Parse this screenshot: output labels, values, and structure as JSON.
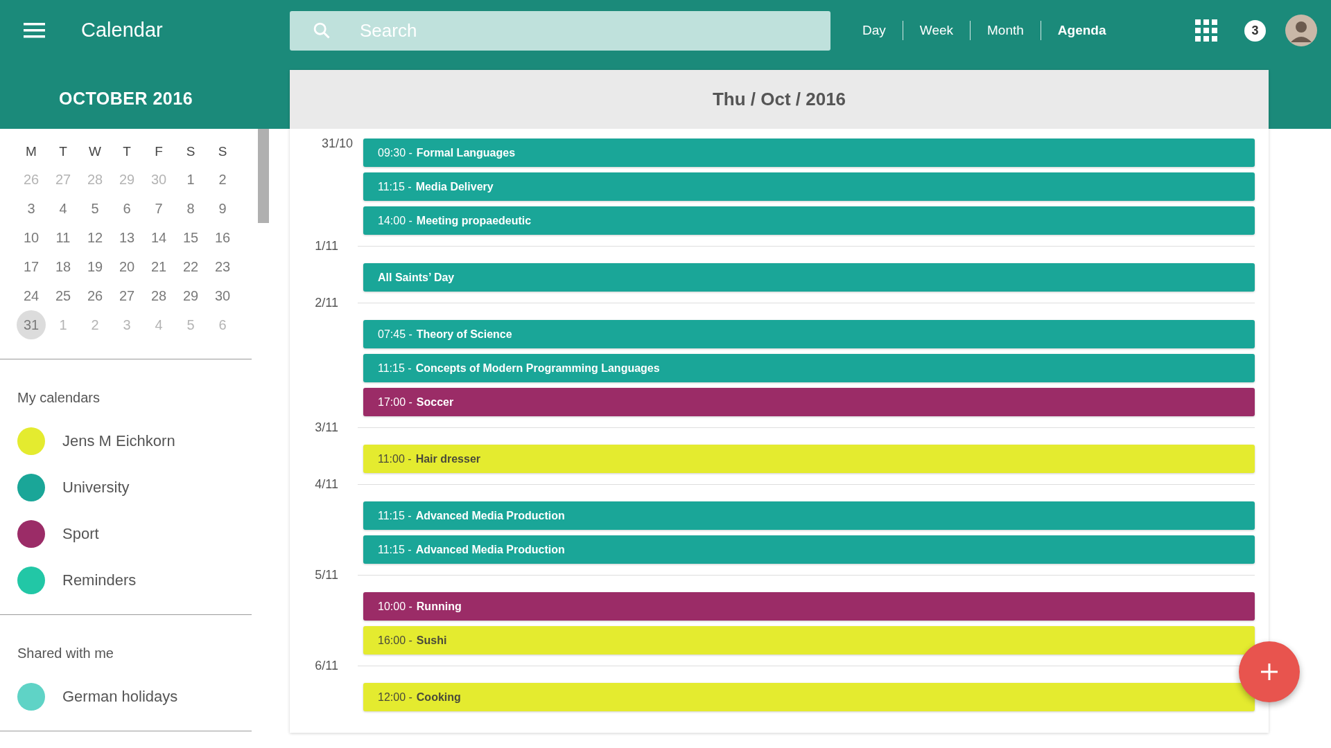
{
  "app_title": "Calendar",
  "search": {
    "placeholder": "Search"
  },
  "views": [
    {
      "label": "Day",
      "selected": false
    },
    {
      "label": "Week",
      "selected": false
    },
    {
      "label": "Month",
      "selected": false
    },
    {
      "label": "Agenda",
      "selected": true
    }
  ],
  "notification_count": "3",
  "mini_calendar": {
    "title": "OCTOBER 2016",
    "weekdays": [
      "M",
      "T",
      "W",
      "T",
      "F",
      "S",
      "S"
    ],
    "days": [
      {
        "label": "26",
        "in_month": false,
        "selected": false
      },
      {
        "label": "27",
        "in_month": false,
        "selected": false
      },
      {
        "label": "28",
        "in_month": false,
        "selected": false
      },
      {
        "label": "29",
        "in_month": false,
        "selected": false
      },
      {
        "label": "30",
        "in_month": false,
        "selected": false
      },
      {
        "label": "1",
        "in_month": true,
        "selected": false
      },
      {
        "label": "2",
        "in_month": true,
        "selected": false
      },
      {
        "label": "3",
        "in_month": true,
        "selected": false
      },
      {
        "label": "4",
        "in_month": true,
        "selected": false
      },
      {
        "label": "5",
        "in_month": true,
        "selected": false
      },
      {
        "label": "6",
        "in_month": true,
        "selected": false
      },
      {
        "label": "7",
        "in_month": true,
        "selected": false
      },
      {
        "label": "8",
        "in_month": true,
        "selected": false
      },
      {
        "label": "9",
        "in_month": true,
        "selected": false
      },
      {
        "label": "10",
        "in_month": true,
        "selected": false
      },
      {
        "label": "11",
        "in_month": true,
        "selected": false
      },
      {
        "label": "12",
        "in_month": true,
        "selected": false
      },
      {
        "label": "13",
        "in_month": true,
        "selected": false
      },
      {
        "label": "14",
        "in_month": true,
        "selected": false
      },
      {
        "label": "15",
        "in_month": true,
        "selected": false
      },
      {
        "label": "16",
        "in_month": true,
        "selected": false
      },
      {
        "label": "17",
        "in_month": true,
        "selected": false
      },
      {
        "label": "18",
        "in_month": true,
        "selected": false
      },
      {
        "label": "19",
        "in_month": true,
        "selected": false
      },
      {
        "label": "20",
        "in_month": true,
        "selected": false
      },
      {
        "label": "21",
        "in_month": true,
        "selected": false
      },
      {
        "label": "22",
        "in_month": true,
        "selected": false
      },
      {
        "label": "23",
        "in_month": true,
        "selected": false
      },
      {
        "label": "24",
        "in_month": true,
        "selected": false
      },
      {
        "label": "25",
        "in_month": true,
        "selected": false
      },
      {
        "label": "26",
        "in_month": true,
        "selected": false
      },
      {
        "label": "27",
        "in_month": true,
        "selected": false
      },
      {
        "label": "28",
        "in_month": true,
        "selected": false
      },
      {
        "label": "29",
        "in_month": true,
        "selected": false
      },
      {
        "label": "30",
        "in_month": true,
        "selected": false
      },
      {
        "label": "31",
        "in_month": true,
        "selected": true
      },
      {
        "label": "1",
        "in_month": false,
        "selected": false
      },
      {
        "label": "2",
        "in_month": false,
        "selected": false
      },
      {
        "label": "3",
        "in_month": false,
        "selected": false
      },
      {
        "label": "4",
        "in_month": false,
        "selected": false
      },
      {
        "label": "5",
        "in_month": false,
        "selected": false
      },
      {
        "label": "6",
        "in_month": false,
        "selected": false
      }
    ]
  },
  "calendar_sections": [
    {
      "title": "My calendars",
      "items": [
        {
          "name": "Jens M Eichkorn",
          "color": "#e4eb2f"
        },
        {
          "name": "University",
          "color": "#1aa698"
        },
        {
          "name": "Sport",
          "color": "#9b2c67"
        },
        {
          "name": "Reminders",
          "color": "#22c7a6"
        }
      ]
    },
    {
      "title": "Shared with me",
      "items": [
        {
          "name": "German holidays",
          "color": "#5fd3c6"
        }
      ]
    }
  ],
  "agenda": {
    "title": "Thu / Oct / 2016",
    "days": [
      {
        "date": "31/10",
        "events": [
          {
            "time": "09:30 -",
            "title": "Formal Languages",
            "color": "#1aa698"
          },
          {
            "time": "11:15 -",
            "title": "Media Delivery",
            "color": "#1aa698"
          },
          {
            "time": "14:00 -",
            "title": "Meeting propaedeutic",
            "color": "#1aa698"
          }
        ]
      },
      {
        "date": "1/11",
        "events": [
          {
            "title": "All Saints’ Day",
            "color": "#1aa698"
          }
        ]
      },
      {
        "date": "2/11",
        "events": [
          {
            "time": "07:45 -",
            "title": "Theory of Science",
            "color": "#1aa698"
          },
          {
            "time": "11:15 -",
            "title": "Concepts of Modern Programming Languages",
            "color": "#1aa698"
          },
          {
            "time": "17:00 -",
            "title": "Soccer",
            "color": "#9b2c67"
          }
        ]
      },
      {
        "date": "3/11",
        "events": [
          {
            "time": "11:00 -",
            "title": "Hair dresser",
            "color": "#e4eb2f"
          }
        ]
      },
      {
        "date": "4/11",
        "events": [
          {
            "time": "11:15 -",
            "title": "Advanced Media Production",
            "color": "#1aa698"
          },
          {
            "time": "11:15 -",
            "title": "Advanced Media Production",
            "color": "#1aa698"
          }
        ]
      },
      {
        "date": "5/11",
        "events": [
          {
            "time": "10:00 -",
            "title": "Running",
            "color": "#9b2c67"
          },
          {
            "time": "16:00 -",
            "title": "Sushi",
            "color": "#e4eb2f"
          }
        ]
      },
      {
        "date": "6/11",
        "events": [
          {
            "time": "12:00 -",
            "title": "Cooking",
            "color": "#e4eb2f"
          }
        ]
      }
    ]
  }
}
